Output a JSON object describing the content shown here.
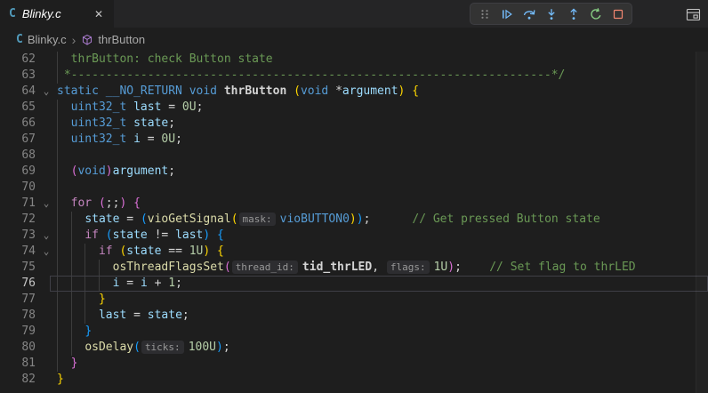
{
  "tab": {
    "label": "Blinky.c",
    "close_glyph": "✕"
  },
  "toolbar": {
    "buttons": [
      "drag-handle",
      "continue",
      "step-over",
      "step-into",
      "step-out",
      "restart",
      "stop"
    ]
  },
  "breadcrumb": {
    "separator": "›",
    "items": [
      {
        "icon": "c-file-icon",
        "label": "Blinky.c"
      },
      {
        "icon": "symbol-method-icon",
        "label": "thrButton"
      }
    ]
  },
  "colors": {
    "keyword": "#569cd6",
    "control_keyword": "#c586c0",
    "function": "#dcdcaa",
    "variable": "#9cdcfe",
    "number": "#b5cea8",
    "comment": "#6a9955",
    "bracket_level1": "#ffd700",
    "bracket_level2": "#da70d6",
    "bracket_level3": "#179fff",
    "debug_blue": "#75beff",
    "debug_green": "#89d185",
    "debug_red": "#f48771",
    "c_file_icon_blue": "#519aba",
    "symbol_purple": "#b180d7"
  },
  "editor": {
    "lines": [
      {
        "num": 62,
        "guides": [
          0
        ],
        "fold": false,
        "current": false,
        "tokens": [
          [
            "cm",
            "  thrButton: check Button state"
          ]
        ]
      },
      {
        "num": 63,
        "guides": [
          0
        ],
        "fold": false,
        "current": false,
        "tokens": [
          [
            "cm",
            " *---------------------------------------------------------------------*/"
          ]
        ]
      },
      {
        "num": 64,
        "guides": [],
        "fold": true,
        "current": false,
        "tokens": [
          [
            "kw",
            "static __NO_RETURN void "
          ],
          [
            "fndef",
            "thrButton "
          ],
          [
            "b1",
            "("
          ],
          [
            "kw",
            "void"
          ],
          [
            "plain",
            " *"
          ],
          [
            "var",
            "argument"
          ],
          [
            "b1",
            ") {"
          ]
        ]
      },
      {
        "num": 65,
        "guides": [
          0
        ],
        "fold": false,
        "current": false,
        "tokens": [
          [
            "plain",
            "  "
          ],
          [
            "kw",
            "uint32_t"
          ],
          [
            "plain",
            " "
          ],
          [
            "var",
            "last"
          ],
          [
            "plain",
            " = "
          ],
          [
            "num",
            "0U"
          ],
          [
            "plain",
            ";"
          ]
        ]
      },
      {
        "num": 66,
        "guides": [
          0
        ],
        "fold": false,
        "current": false,
        "tokens": [
          [
            "plain",
            "  "
          ],
          [
            "kw",
            "uint32_t"
          ],
          [
            "plain",
            " "
          ],
          [
            "var",
            "state"
          ],
          [
            "plain",
            ";"
          ]
        ]
      },
      {
        "num": 67,
        "guides": [
          0
        ],
        "fold": false,
        "current": false,
        "tokens": [
          [
            "plain",
            "  "
          ],
          [
            "kw",
            "uint32_t"
          ],
          [
            "plain",
            " "
          ],
          [
            "var",
            "i"
          ],
          [
            "plain",
            " = "
          ],
          [
            "num",
            "0U"
          ],
          [
            "plain",
            ";"
          ]
        ]
      },
      {
        "num": 68,
        "guides": [
          0
        ],
        "fold": false,
        "current": false,
        "tokens": []
      },
      {
        "num": 69,
        "guides": [
          0
        ],
        "fold": false,
        "current": false,
        "tokens": [
          [
            "plain",
            "  "
          ],
          [
            "b2",
            "("
          ],
          [
            "kw",
            "void"
          ],
          [
            "b2",
            ")"
          ],
          [
            "var",
            "argument"
          ],
          [
            "plain",
            ";"
          ]
        ]
      },
      {
        "num": 70,
        "guides": [
          0
        ],
        "fold": false,
        "current": false,
        "tokens": []
      },
      {
        "num": 71,
        "guides": [
          0
        ],
        "fold": true,
        "current": false,
        "tokens": [
          [
            "plain",
            "  "
          ],
          [
            "ctrl",
            "for"
          ],
          [
            "plain",
            " "
          ],
          [
            "b2",
            "("
          ],
          [
            "plain",
            ";;"
          ],
          [
            "b2",
            ")"
          ],
          [
            "plain",
            " "
          ],
          [
            "b2",
            "{"
          ]
        ]
      },
      {
        "num": 72,
        "guides": [
          0,
          2
        ],
        "fold": false,
        "current": false,
        "tokens": [
          [
            "plain",
            "    "
          ],
          [
            "var",
            "state"
          ],
          [
            "plain",
            " = "
          ],
          [
            "b3",
            "("
          ],
          [
            "fn",
            "vioGetSignal"
          ],
          [
            "b1",
            "("
          ],
          [
            "hint",
            "mask:"
          ],
          [
            "kw",
            "vioBUTTON0"
          ],
          [
            "b1",
            ")"
          ],
          [
            "b3",
            ")"
          ],
          [
            "plain",
            ";      "
          ],
          [
            "cm",
            "// Get pressed Button state"
          ]
        ]
      },
      {
        "num": 73,
        "guides": [
          0,
          2
        ],
        "fold": true,
        "current": false,
        "tokens": [
          [
            "plain",
            "    "
          ],
          [
            "ctrl",
            "if"
          ],
          [
            "plain",
            " "
          ],
          [
            "b3",
            "("
          ],
          [
            "var",
            "state"
          ],
          [
            "plain",
            " != "
          ],
          [
            "var",
            "last"
          ],
          [
            "b3",
            ")"
          ],
          [
            "plain",
            " "
          ],
          [
            "b3",
            "{"
          ]
        ]
      },
      {
        "num": 74,
        "guides": [
          0,
          2,
          4
        ],
        "fold": true,
        "current": false,
        "tokens": [
          [
            "plain",
            "      "
          ],
          [
            "ctrl",
            "if"
          ],
          [
            "plain",
            " "
          ],
          [
            "b1",
            "("
          ],
          [
            "var",
            "state"
          ],
          [
            "plain",
            " == "
          ],
          [
            "num",
            "1U"
          ],
          [
            "b1",
            ")"
          ],
          [
            "plain",
            " "
          ],
          [
            "b1",
            "{"
          ]
        ]
      },
      {
        "num": 75,
        "guides": [
          0,
          2,
          4,
          6
        ],
        "fold": false,
        "current": false,
        "tokens": [
          [
            "plain",
            "        "
          ],
          [
            "fn",
            "osThreadFlagsSet"
          ],
          [
            "b2",
            "("
          ],
          [
            "hint",
            "thread_id:"
          ],
          [
            "glob",
            "tid_thrLED"
          ],
          [
            "plain",
            ", "
          ],
          [
            "hint",
            "flags:"
          ],
          [
            "num",
            "1U"
          ],
          [
            "b2",
            ")"
          ],
          [
            "plain",
            ";    "
          ],
          [
            "cm",
            "// Set flag to thrLED"
          ]
        ]
      },
      {
        "num": 76,
        "guides": [
          0,
          2,
          4,
          6
        ],
        "fold": false,
        "current": true,
        "tokens": [
          [
            "plain",
            "        "
          ],
          [
            "var",
            "i"
          ],
          [
            "plain",
            " = "
          ],
          [
            "var",
            "i"
          ],
          [
            "plain",
            " + "
          ],
          [
            "num",
            "1"
          ],
          [
            "plain",
            ";"
          ]
        ]
      },
      {
        "num": 77,
        "guides": [
          0,
          2,
          4
        ],
        "fold": false,
        "current": false,
        "tokens": [
          [
            "plain",
            "      "
          ],
          [
            "b1",
            "}"
          ]
        ]
      },
      {
        "num": 78,
        "guides": [
          0,
          2,
          4
        ],
        "fold": false,
        "current": false,
        "tokens": [
          [
            "plain",
            "      "
          ],
          [
            "var",
            "last"
          ],
          [
            "plain",
            " = "
          ],
          [
            "var",
            "state"
          ],
          [
            "plain",
            ";"
          ]
        ]
      },
      {
        "num": 79,
        "guides": [
          0,
          2
        ],
        "fold": false,
        "current": false,
        "tokens": [
          [
            "plain",
            "    "
          ],
          [
            "b3",
            "}"
          ]
        ]
      },
      {
        "num": 80,
        "guides": [
          0,
          2
        ],
        "fold": false,
        "current": false,
        "tokens": [
          [
            "plain",
            "    "
          ],
          [
            "fn",
            "osDelay"
          ],
          [
            "b3",
            "("
          ],
          [
            "hint",
            "ticks:"
          ],
          [
            "num",
            "100U"
          ],
          [
            "b3",
            ")"
          ],
          [
            "plain",
            ";"
          ]
        ]
      },
      {
        "num": 81,
        "guides": [
          0
        ],
        "fold": false,
        "current": false,
        "tokens": [
          [
            "plain",
            "  "
          ],
          [
            "b2",
            "}"
          ]
        ]
      },
      {
        "num": 82,
        "guides": [],
        "fold": false,
        "current": false,
        "tokens": [
          [
            "b1",
            "}"
          ]
        ]
      }
    ]
  }
}
